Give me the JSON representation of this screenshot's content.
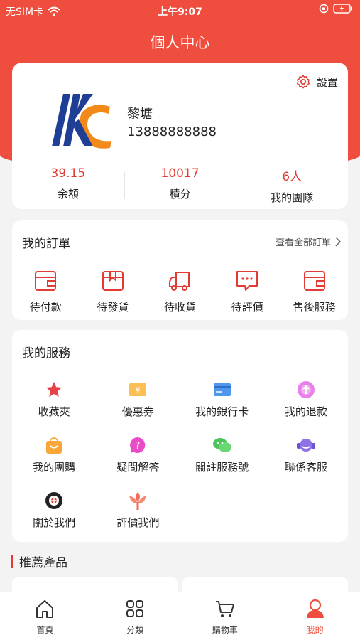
{
  "status_bar": {
    "carrier": "无SIM卡",
    "time": "上午9:07"
  },
  "title": "個人中心",
  "profile": {
    "settings_label": "設置",
    "name": "黎塘",
    "phone": "13888888888",
    "stats": [
      {
        "value": "39.15",
        "label": "余額"
      },
      {
        "value": "10017",
        "label": "積分"
      },
      {
        "value": "6人",
        "label": "我的團隊"
      }
    ]
  },
  "orders": {
    "title": "我的訂單",
    "view_all": "查看全部訂單",
    "items": [
      {
        "label": "待付款",
        "icon": "wallet-icon"
      },
      {
        "label": "待發貨",
        "icon": "package-icon"
      },
      {
        "label": "待收貨",
        "icon": "truck-icon"
      },
      {
        "label": "待評價",
        "icon": "comment-icon"
      },
      {
        "label": "售後服務",
        "icon": "after-sales-icon"
      }
    ]
  },
  "services": {
    "title": "我的服務",
    "items": [
      {
        "label": "收藏夾",
        "icon": "star-icon"
      },
      {
        "label": "優惠券",
        "icon": "coupon-icon"
      },
      {
        "label": "我的銀行卡",
        "icon": "bank-card-icon"
      },
      {
        "label": "我的退款",
        "icon": "refund-icon"
      },
      {
        "label": "我的團購",
        "icon": "group-buy-icon"
      },
      {
        "label": "疑問解答",
        "icon": "faq-icon"
      },
      {
        "label": "關註服務號",
        "icon": "wechat-icon"
      },
      {
        "label": "聯係客服",
        "icon": "customer-service-icon"
      },
      {
        "label": "關於我們",
        "icon": "about-icon"
      },
      {
        "label": "評價我們",
        "icon": "rate-icon"
      }
    ]
  },
  "recommend_title": "推薦產品",
  "tabs": [
    {
      "label": "首頁",
      "icon": "home-icon"
    },
    {
      "label": "分類",
      "icon": "grid-icon"
    },
    {
      "label": "購物車",
      "icon": "cart-icon"
    },
    {
      "label": "我的",
      "icon": "user-icon",
      "active": true
    }
  ],
  "colors": {
    "brand": "#ef4d3d",
    "accent_text": "#e23b34"
  }
}
